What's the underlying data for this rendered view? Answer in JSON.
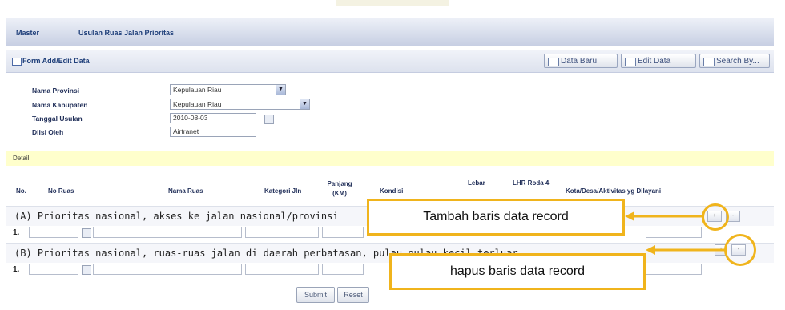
{
  "header": {
    "crumb_root": "Master",
    "crumb_page": "Usulan Ruas Jalan Prioritas"
  },
  "form": {
    "title": "Form Add/Edit Data",
    "toolbar": {
      "new": "Data Baru",
      "edit": "Edit Data",
      "search": "Search By..."
    },
    "fields": {
      "provinsi": {
        "label": "Nama Provinsi",
        "value": "Kepulauan Riau"
      },
      "kabupaten": {
        "label": "Nama Kabupaten",
        "value": "Kepulauan Riau"
      },
      "tanggal": {
        "label": "Tanggal Usulan",
        "value": "2010-08-03"
      },
      "diisi": {
        "label": "Diisi Oleh",
        "value": "Airtranet"
      }
    }
  },
  "detail": {
    "label": "Detail",
    "columns": {
      "no": "No.",
      "no_ruas": "No Ruas",
      "nama_ruas": "Nama Ruas",
      "kategori": "Kategori Jln",
      "panjang": "Panjang (KM)",
      "kondisi": "Kondisi",
      "lebar": "Lebar",
      "lhr": "LHR Roda 4",
      "kota": "Kota/Desa/Aktivitas yg Dilayani"
    },
    "sections": [
      {
        "title": "(A) Prioritas nasional, akses ke jalan nasional/provinsi",
        "row_no": "1."
      },
      {
        "title": "(B) Prioritas nasional, ruas-ruas jalan di daerah perbatasan, pulau-pulau kecil terluar",
        "row_no": "1."
      }
    ],
    "add_btn": "+",
    "remove_btn": "-"
  },
  "buttons": {
    "submit": "Submit",
    "reset": "Reset"
  },
  "annotations": {
    "add": "Tambah baris data record",
    "remove": "hapus baris data record"
  },
  "colors": {
    "accent": "#f0b41c",
    "header": "#c7cfe3",
    "detail_bg": "#ffffcc"
  }
}
